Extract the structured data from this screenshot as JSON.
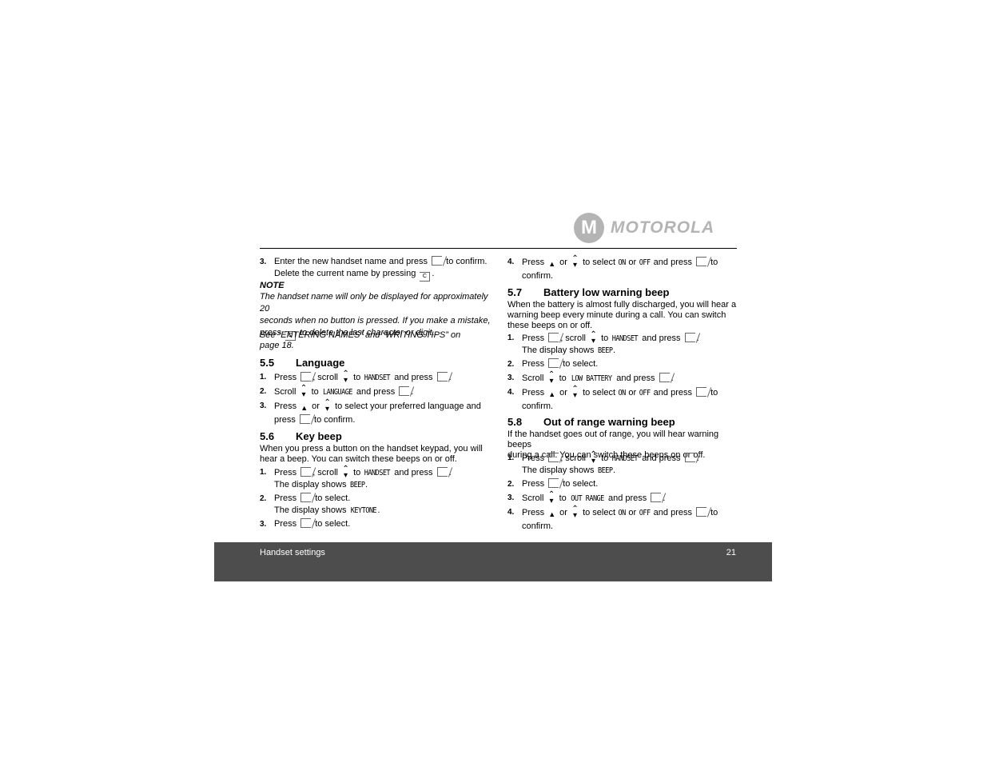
{
  "brand": {
    "logo_text": "MOTOROLA",
    "logo_mark": "M"
  },
  "footer": {
    "section": "Handset settings",
    "page": "21"
  },
  "left": {
    "step3": {
      "num": "3.",
      "lines": [
        [
          "Enter the new handset name and press ",
          {
            "icon": "menu-ok-icon"
          },
          " to confirm."
        ],
        [
          "Delete the current name by pressing ",
          {
            "icon": "delete-icon"
          },
          "."
        ]
      ]
    },
    "note_label": "NOTE",
    "note_lines": [
      [
        "The handset name will only be displayed for approximately 20"
      ],
      [
        "seconds when no button is pressed. If you make a mistake,"
      ],
      [
        "press ",
        {
          "icon": "delete-icon"
        },
        " to delete the last character or digit."
      ]
    ],
    "see_lines": [
      [
        "See “ENTERING NAMES” and “WRITING TIPS” on"
      ],
      [
        "page 18."
      ]
    ],
    "s55": {
      "num": "5.5",
      "title": "Language",
      "steps": [
        {
          "num": "1.",
          "lines": [
            [
              "Press ",
              {
                "icon": "menu-ok-icon"
              },
              ", scroll ",
              {
                "icon": "scroll-icon"
              },
              " to ",
              {
                "key": "HANDSET"
              },
              " and press ",
              {
                "icon": "menu-ok-icon"
              },
              "."
            ]
          ]
        },
        {
          "num": "2.",
          "lines": [
            [
              "Scroll ",
              {
                "icon": "scroll-icon"
              },
              " to ",
              {
                "key": "LANGUAGE"
              },
              " and press ",
              {
                "icon": "menu-ok-icon"
              },
              "."
            ]
          ]
        },
        {
          "num": "3.",
          "lines": [
            [
              "Press ",
              {
                "icon": "up-arrow-icon"
              },
              " or ",
              {
                "icon": "scroll-icon"
              },
              " to select your preferred language and"
            ],
            [
              "press ",
              {
                "icon": "menu-ok-icon"
              },
              " to confirm."
            ]
          ]
        }
      ]
    },
    "s56": {
      "num": "5.6",
      "title": "Key beep",
      "intro": [
        [
          "When you press a button on the handset keypad, you will"
        ],
        [
          "hear a beep. You can switch these beeps on or off."
        ]
      ],
      "steps": [
        {
          "num": "1.",
          "lines": [
            [
              "Press ",
              {
                "icon": "menu-ok-icon"
              },
              ", scroll ",
              {
                "icon": "scroll-icon"
              },
              " to ",
              {
                "key": "HANDSET"
              },
              " and press ",
              {
                "icon": "menu-ok-icon"
              },
              "."
            ],
            [
              "The display shows ",
              {
                "key": "BEEP"
              },
              "."
            ]
          ]
        },
        {
          "num": "2.",
          "lines": [
            [
              "Press ",
              {
                "icon": "menu-ok-icon"
              },
              " to select."
            ],
            [
              "The display shows ",
              {
                "key": "KEYTONE"
              },
              "."
            ]
          ]
        },
        {
          "num": "3.",
          "lines": [
            [
              "Press ",
              {
                "icon": "menu-ok-icon"
              },
              " to select."
            ]
          ]
        }
      ]
    }
  },
  "right": {
    "step4": {
      "num": "4.",
      "lines": [
        [
          "Press ",
          {
            "icon": "up-arrow-icon"
          },
          " or ",
          {
            "icon": "scroll-icon"
          },
          " to select ",
          {
            "key": "ON"
          },
          " or ",
          {
            "key": "OFF"
          },
          " and press ",
          {
            "icon": "menu-ok-icon"
          },
          " to"
        ],
        [
          "confirm."
        ]
      ]
    },
    "s57": {
      "num": "5.7",
      "title": "Battery low warning beep",
      "intro": [
        [
          "When the battery is almost fully discharged, you will hear a"
        ],
        [
          "warning beep every minute during a call. You can switch"
        ],
        [
          "these beeps on or off."
        ]
      ],
      "steps": [
        {
          "num": "1.",
          "lines": [
            [
              "Press ",
              {
                "icon": "menu-ok-icon"
              },
              ", scroll ",
              {
                "icon": "scroll-icon"
              },
              " to ",
              {
                "key": "HANDSET"
              },
              " and press ",
              {
                "icon": "menu-ok-icon"
              },
              "."
            ],
            [
              "The display shows ",
              {
                "key": "BEEP"
              },
              "."
            ]
          ]
        },
        {
          "num": "2.",
          "lines": [
            [
              "Press ",
              {
                "icon": "menu-ok-icon"
              },
              " to select."
            ]
          ]
        },
        {
          "num": "3.",
          "lines": [
            [
              "Scroll ",
              {
                "icon": "scroll-icon"
              },
              " to ",
              {
                "key": "LOW BATTERY"
              },
              " and press ",
              {
                "icon": "menu-ok-icon"
              },
              "."
            ]
          ]
        },
        {
          "num": "4.",
          "lines": [
            [
              "Press ",
              {
                "icon": "up-arrow-icon"
              },
              " or ",
              {
                "icon": "scroll-icon"
              },
              " to select ",
              {
                "key": "ON"
              },
              " or ",
              {
                "key": "OFF"
              },
              " and press ",
              {
                "icon": "menu-ok-icon"
              },
              " to"
            ],
            [
              "confirm."
            ]
          ]
        }
      ]
    },
    "s58": {
      "num": "5.8",
      "title": "Out of range warning beep",
      "intro": [
        [
          "If the handset goes out of range, you will hear warning beeps"
        ],
        [
          "during a call. You can switch these beeps on or off."
        ]
      ],
      "steps": [
        {
          "num": "1.",
          "lines": [
            [
              "Press ",
              {
                "icon": "menu-ok-icon"
              },
              ", scroll ",
              {
                "icon": "scroll-icon"
              },
              " to ",
              {
                "key": "HANDSET"
              },
              " and press ",
              {
                "icon": "menu-ok-icon"
              },
              "."
            ],
            [
              "The display shows ",
              {
                "key": "BEEP"
              },
              "."
            ]
          ]
        },
        {
          "num": "2.",
          "lines": [
            [
              "Press ",
              {
                "icon": "menu-ok-icon"
              },
              " to select."
            ]
          ]
        },
        {
          "num": "3.",
          "lines": [
            [
              "Scroll ",
              {
                "icon": "scroll-icon"
              },
              " to ",
              {
                "key": "OUT RANGE"
              },
              " and press ",
              {
                "icon": "menu-ok-icon"
              },
              "."
            ]
          ]
        },
        {
          "num": "4.",
          "lines": [
            [
              "Press ",
              {
                "icon": "up-arrow-icon"
              },
              " or ",
              {
                "icon": "scroll-icon"
              },
              " to select ",
              {
                "key": "ON"
              },
              " or ",
              {
                "key": "OFF"
              },
              " and press ",
              {
                "icon": "menu-ok-icon"
              },
              " to"
            ],
            [
              "confirm."
            ]
          ]
        }
      ]
    }
  }
}
